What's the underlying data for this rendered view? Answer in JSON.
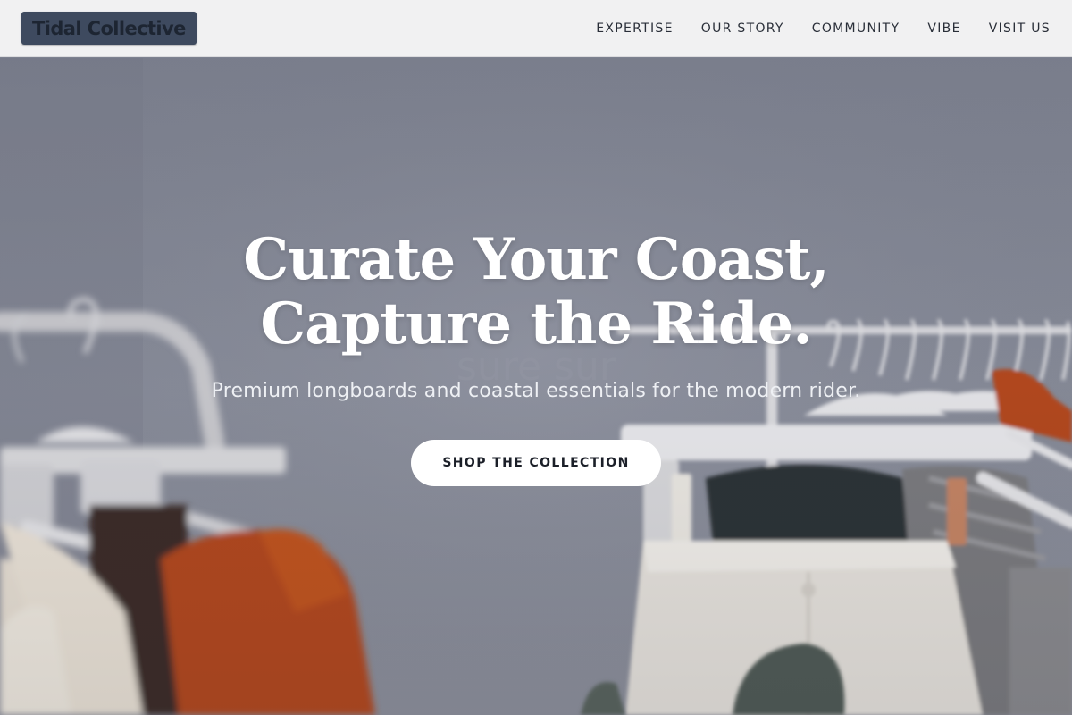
{
  "brand": {
    "logo_text": "Tidal Collective"
  },
  "nav": {
    "items": [
      {
        "label": "EXPERTISE"
      },
      {
        "label": "OUR STORY"
      },
      {
        "label": "COMMUNITY"
      },
      {
        "label": "VIBE"
      },
      {
        "label": "VISIT US"
      }
    ]
  },
  "hero": {
    "title_line1": "Curate Your Coast,",
    "title_line2": "Capture the Ride.",
    "subtitle": "Premium longboards and coastal essentials for the modern rider.",
    "cta_label": "SHOP THE COLLECTION",
    "background_image": "clothing-rack-photo"
  },
  "colors": {
    "nav_bg": "#f1f1f2",
    "logo_bg": "#3e4a5f",
    "hero_tint": "#7d8290",
    "cta_bg": "#ffffff",
    "accent_rust": "#b4471c"
  }
}
